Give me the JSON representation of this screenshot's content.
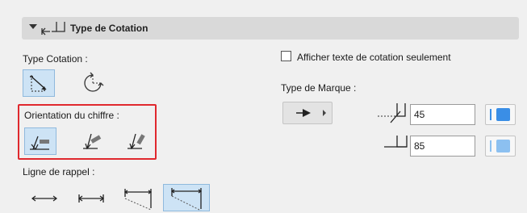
{
  "panel": {
    "title": "Type de Cotation",
    "collapse_icon": "triangle-down-icon",
    "header_icon": "dimension-marker-icon"
  },
  "type_cotation": {
    "label": "Type Cotation :",
    "buttons": [
      {
        "icon": "linear-dimension-icon",
        "selected": true
      },
      {
        "icon": "radial-dimension-icon",
        "selected": false
      }
    ]
  },
  "orientation": {
    "label": "Orientation du chiffre :",
    "buttons": [
      {
        "icon": "text-horizontal-icon",
        "selected": true
      },
      {
        "icon": "text-angled-icon",
        "selected": false
      },
      {
        "icon": "text-steep-icon",
        "selected": false
      }
    ]
  },
  "ligne_rappel": {
    "label": "Ligne de rappel :",
    "buttons": [
      {
        "icon": "line-no-extension-icon",
        "selected": false
      },
      {
        "icon": "line-ticks-icon",
        "selected": false
      },
      {
        "icon": "line-partial-extension-icon",
        "selected": false
      },
      {
        "icon": "line-full-extension-icon",
        "selected": true
      }
    ]
  },
  "afficher": {
    "label": "Afficher texte de cotation seulement",
    "checked": false
  },
  "marque": {
    "label": "Type de Marque :",
    "dropdown_icon": "arrow-marker-icon",
    "angle_value": "45",
    "size_value": "85",
    "angle_icon": "marker-angle-icon",
    "size_icon": "marker-size-icon",
    "pen_color_1": "#3a8ee6",
    "pen_color_2": "#8cc0f0"
  }
}
